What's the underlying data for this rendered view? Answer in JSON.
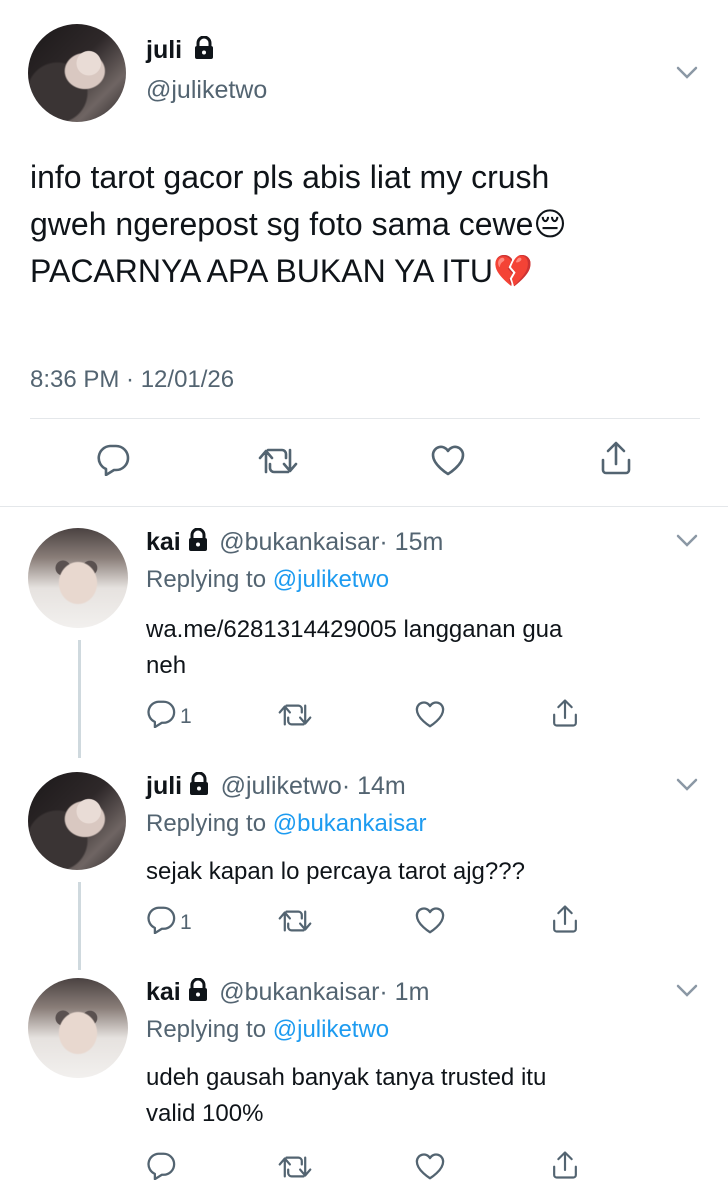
{
  "main_tweet": {
    "name": "juli",
    "handle": "@juliketwo",
    "text_lines": [
      "info tarot gacor pls abis liat my crush",
      "gweh ngerepost sg foto sama cewe😔",
      "PACARNYA APA BUKAN YA ITU💔"
    ],
    "timestamp": "8:36 PM · 12/01/26"
  },
  "replies": [
    {
      "name": "kai",
      "handle": "@bukankaisar",
      "time": "· 15m",
      "replying_prefix": "Replying to",
      "replying_to": "@juliketwo",
      "text_lines": [
        "wa.me/6281314429005 langganan gua",
        "neh"
      ],
      "reply_count": "1"
    },
    {
      "name": "juli",
      "handle": "@juliketwo",
      "time": "· 14m",
      "replying_prefix": "Replying to",
      "replying_to": "@bukankaisar",
      "text_lines": [
        "sejak kapan lo percaya tarot ajg???"
      ],
      "reply_count": "1"
    },
    {
      "name": "kai",
      "handle": "@bukankaisar",
      "time": "· 1m",
      "replying_prefix": "Replying to",
      "replying_to": "@juliketwo",
      "text_lines": [
        "udeh gausah banyak tanya trusted itu",
        "valid 100%"
      ],
      "reply_count": ""
    }
  ],
  "icons": {
    "lock": "lock-icon",
    "chevron": "chevron-down-icon",
    "reply": "reply-icon",
    "retweet": "retweet-icon",
    "like": "heart-icon",
    "share": "share-icon"
  },
  "colors": {
    "text": "#0f1419",
    "secondary": "#536471",
    "link": "#1d9bf0",
    "divider": "#e4e7ea"
  }
}
